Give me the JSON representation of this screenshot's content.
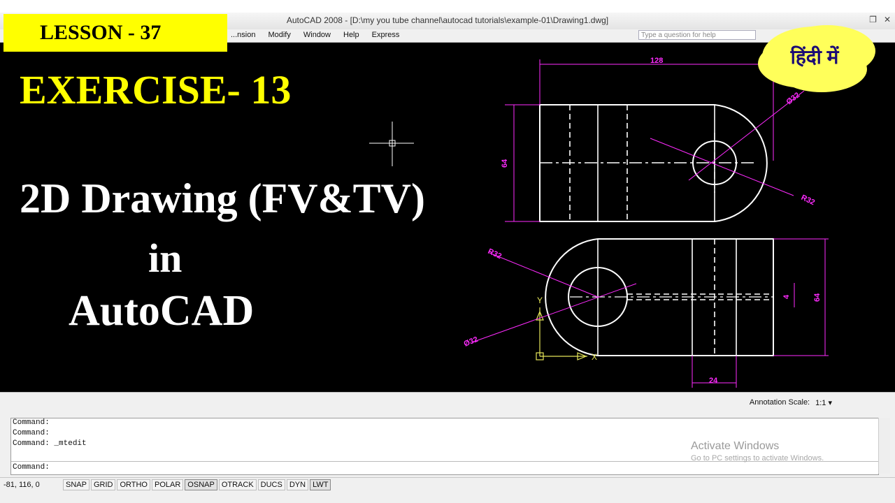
{
  "window": {
    "title": "AutoCAD 2008 - [D:\\my you tube channel\\autocad tutorials\\example-01\\Drawing1.dwg]"
  },
  "menu": {
    "items": [
      "...nsion",
      "Modify",
      "Window",
      "Help",
      "Express"
    ],
    "help_placeholder": "Type a question for help"
  },
  "overlay": {
    "lesson": "LESSON - 37",
    "hindi": "हिंदी में",
    "exercise": "EXERCISE- 13",
    "line1": "2D Drawing (FV&TV)",
    "line2": "in",
    "line3": "AutoCAD"
  },
  "drawing": {
    "dims": {
      "top_width": "128",
      "front_height": "64",
      "top_radius": "R32",
      "top_dia": "Ø32",
      "top_radius2": "R32",
      "top_dia2": "Ø32",
      "slot_height": "4",
      "top_height": "64",
      "slot_width": "24"
    }
  },
  "annotation": {
    "label": "Annotation Scale:",
    "value": "1:1 ▾"
  },
  "command": {
    "lines": [
      "Command:",
      "Command:",
      "Command:  _mtedit"
    ],
    "prompt": "Command:"
  },
  "watermark": {
    "title": "Activate Windows",
    "sub": "Go to PC settings to activate Windows."
  },
  "status": {
    "coords": "-81, 116, 0",
    "toggles": [
      "SNAP",
      "GRID",
      "ORTHO",
      "POLAR",
      "OSNAP",
      "OTRACK",
      "DUCS",
      "DYN",
      "LWT"
    ]
  },
  "colors": {
    "dimension": "#ff2bff",
    "geometry": "#ffffff",
    "accent_yellow": "#ffff00"
  }
}
